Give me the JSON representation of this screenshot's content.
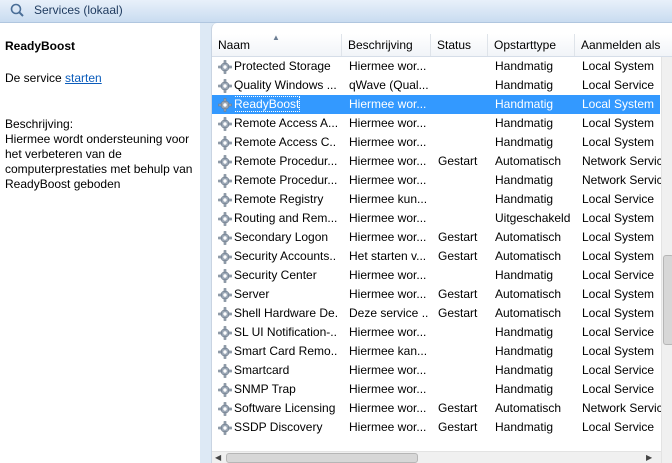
{
  "window": {
    "title": "Services (lokaal)"
  },
  "details": {
    "service_name": "ReadyBoost",
    "action_prefix": "De service",
    "action_link": "starten",
    "description_label": "Beschrijving:",
    "description": "Hiermee wordt ondersteuning voor het verbeteren van de computerprestaties met behulp van ReadyBoost geboden"
  },
  "columns": {
    "name": "Naam",
    "description": "Beschrijving",
    "status": "Status",
    "startup": "Opstarttype",
    "logon": "Aanmelden als"
  },
  "rows": [
    {
      "name": "Protected Storage",
      "desc": "Hiermee wor...",
      "status": "",
      "startup": "Handmatig",
      "logon": "Local System"
    },
    {
      "name": "Quality Windows ...",
      "desc": "qWave (Qual...",
      "status": "",
      "startup": "Handmatig",
      "logon": "Local Service"
    },
    {
      "name": "ReadyBoost",
      "desc": "Hiermee wor...",
      "status": "",
      "startup": "Handmatig",
      "logon": "Local System",
      "selected": true
    },
    {
      "name": "Remote Access A...",
      "desc": "Hiermee wor...",
      "status": "",
      "startup": "Handmatig",
      "logon": "Local System"
    },
    {
      "name": "Remote Access C...",
      "desc": "Hiermee wor...",
      "status": "",
      "startup": "Handmatig",
      "logon": "Local System"
    },
    {
      "name": "Remote Procedur...",
      "desc": "Hiermee wor...",
      "status": "Gestart",
      "startup": "Automatisch",
      "logon": "Network Service"
    },
    {
      "name": "Remote Procedur...",
      "desc": "Hiermee wor...",
      "status": "",
      "startup": "Handmatig",
      "logon": "Network Service"
    },
    {
      "name": "Remote Registry",
      "desc": "Hiermee kun...",
      "status": "",
      "startup": "Handmatig",
      "logon": "Local Service"
    },
    {
      "name": "Routing and Rem...",
      "desc": "Hiermee wor...",
      "status": "",
      "startup": "Uitgeschakeld",
      "logon": "Local System"
    },
    {
      "name": "Secondary Logon",
      "desc": "Hiermee wor...",
      "status": "Gestart",
      "startup": "Automatisch",
      "logon": "Local System"
    },
    {
      "name": "Security Accounts...",
      "desc": "Het starten v...",
      "status": "Gestart",
      "startup": "Automatisch",
      "logon": "Local System"
    },
    {
      "name": "Security Center",
      "desc": "Hiermee wor...",
      "status": "",
      "startup": "Handmatig",
      "logon": "Local Service"
    },
    {
      "name": "Server",
      "desc": "Hiermee wor...",
      "status": "Gestart",
      "startup": "Automatisch",
      "logon": "Local System"
    },
    {
      "name": "Shell Hardware De...",
      "desc": "Deze service ...",
      "status": "Gestart",
      "startup": "Automatisch",
      "logon": "Local System"
    },
    {
      "name": "SL UI Notification-...",
      "desc": "Hiermee wor...",
      "status": "",
      "startup": "Handmatig",
      "logon": "Local Service"
    },
    {
      "name": "Smart Card Remo...",
      "desc": "Hiermee kan...",
      "status": "",
      "startup": "Handmatig",
      "logon": "Local System"
    },
    {
      "name": "Smartcard",
      "desc": "Hiermee wor...",
      "status": "",
      "startup": "Handmatig",
      "logon": "Local Service"
    },
    {
      "name": "SNMP Trap",
      "desc": "Hiermee wor...",
      "status": "",
      "startup": "Handmatig",
      "logon": "Local Service"
    },
    {
      "name": "Software Licensing",
      "desc": "Hiermee wor...",
      "status": "Gestart",
      "startup": "Automatisch",
      "logon": "Network Service"
    },
    {
      "name": "SSDP Discovery",
      "desc": "Hiermee wor...",
      "status": "Gestart",
      "startup": "Handmatig",
      "logon": "Local Service"
    }
  ],
  "colors": {
    "selection": "#3399ff",
    "link": "#0b5cbb"
  },
  "icons": {
    "title": "services-icon",
    "row": "gear-icon",
    "sort": "sort-ascending-icon"
  }
}
